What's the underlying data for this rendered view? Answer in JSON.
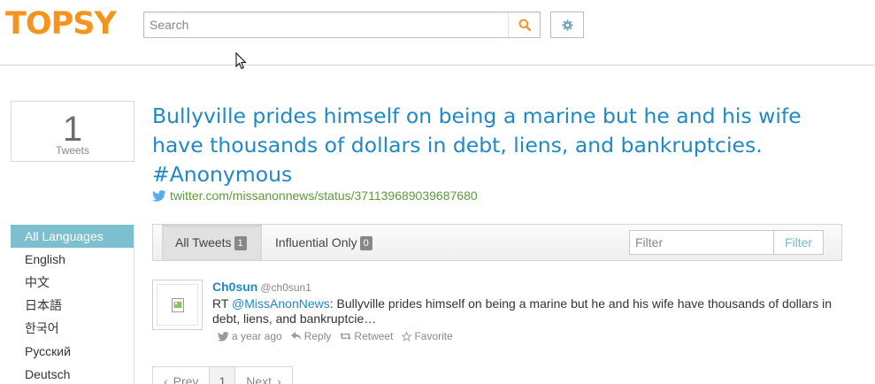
{
  "header": {
    "logo": "TOPSY",
    "search": {
      "placeholder": "Search",
      "value": ""
    }
  },
  "sidebar": {
    "count": "1",
    "count_label": "Tweets",
    "languages": [
      "All Languages",
      "English",
      "中文",
      "日本語",
      "한국어",
      "Русский",
      "Deutsch"
    ],
    "active_language": "All Languages"
  },
  "main": {
    "headline": "Bullyville prides himself on being a marine but he and his wife have thousands of dollars in debt, liens, and bankruptcies. #Anonymous",
    "source_url": "twitter.com/missanonnews/status/371139689039687680",
    "tabs": [
      {
        "label": "All Tweets",
        "count": "1"
      },
      {
        "label": "Influential Only",
        "count": "0"
      }
    ],
    "filter": {
      "placeholder": "Filter",
      "button": "Filter"
    }
  },
  "tweet": {
    "name": "Ch0sun",
    "handle": "@ch0sun1",
    "text_prefix": "RT ",
    "mention": "@MissAnonNews",
    "text": ": Bullyville prides himself on being a marine but he and his wife have thousands of dollars in debt, liens, and bankruptcie…",
    "time": "a year ago",
    "reply": "Reply",
    "retweet": "Retweet",
    "favorite": "Favorite"
  },
  "pagination": {
    "prev": "Prev",
    "current": "1",
    "next": "Next"
  },
  "colors": {
    "brand": "#f7941d",
    "link": "#1f88c6",
    "source_link": "#5d9b3a",
    "active_language": "#7cc0d0"
  }
}
